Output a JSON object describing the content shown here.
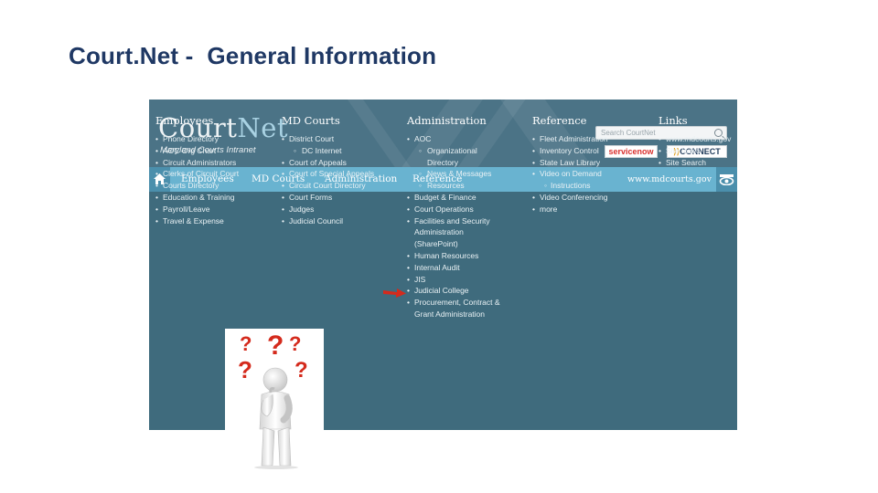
{
  "slide": {
    "title": "Court.Net -  General Information"
  },
  "header": {
    "logo_main": "Court",
    "logo_accent": "Net",
    "logo_subtitle": "Maryland Courts Intranet",
    "search_placeholder": "Search CourtNet",
    "servicenow_label": "servicenow",
    "connect_label": "CONNECT"
  },
  "nav": {
    "items": [
      "Employees",
      "MD Courts",
      "Administration",
      "Reference"
    ],
    "site_link": "www.mdcourts.gov"
  },
  "columns": {
    "employees": {
      "title": "Employees",
      "items": [
        "Phone Directory",
        "AOC Org Chart",
        "Circuit Administrators",
        "Clerks of Circuit Court",
        "Courts Directory",
        "Education & Training",
        "Payroll/Leave",
        "Travel & Expense"
      ]
    },
    "md_courts": {
      "title": "MD Courts",
      "items": [
        "District Court",
        "DC Internet",
        "Court of Appeals",
        "Court of Special Appeals",
        "Circuit Court Directory",
        "Court Forms",
        "Judges",
        "Judicial Council"
      ]
    },
    "administration": {
      "title": "Administration",
      "items": [
        "AOC",
        "Organizational",
        "Directory",
        "News & Messages",
        "Resources",
        "Budget & Finance",
        "Court Operations",
        "Facilities and Security",
        "Administration",
        "(SharePoint)",
        "Human Resources",
        "Internal Audit",
        "JIS",
        "Judicial College",
        "Procurement, Contract &",
        "Grant Administration"
      ]
    },
    "reference": {
      "title": "Reference",
      "items": [
        "Fleet Administration",
        "Inventory Control",
        "State Law Library",
        "Video on Demand",
        "Instructions",
        "Video Conferencing",
        "more"
      ]
    },
    "links": {
      "title": "Links",
      "items": [
        "www.mdcourts.gov",
        "Site Index",
        "Site Search"
      ]
    }
  },
  "figure": {
    "marks": [
      "?",
      "?",
      "?",
      "?",
      "?"
    ]
  },
  "colors": {
    "panel": "#3f6b7d",
    "navbar": "#69b3d0",
    "title": "#1f3864",
    "arrow": "#d42a1c"
  }
}
